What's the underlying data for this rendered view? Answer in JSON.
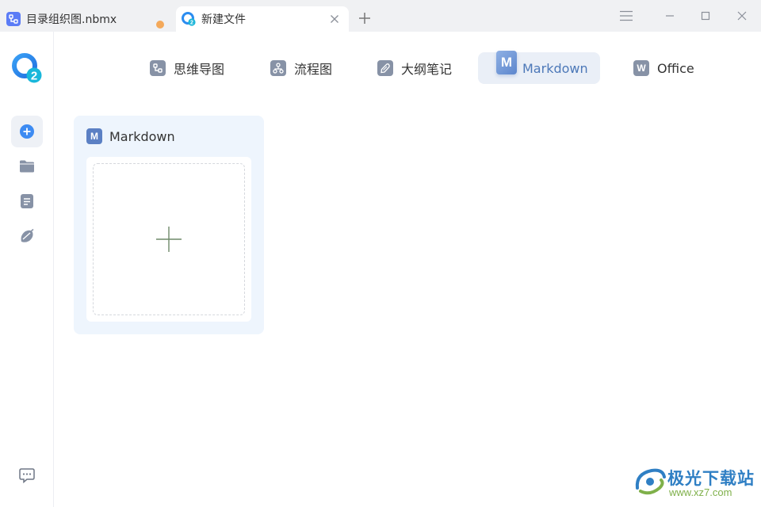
{
  "tabs": [
    {
      "title": "目录组织图.nbmx",
      "icon": "mindmap-file-icon",
      "unsaved": true
    },
    {
      "title": "新建文件",
      "icon": "app-logo-icon",
      "active": true
    }
  ],
  "categories": [
    {
      "label": "思维导图",
      "icon": "mindmap-icon"
    },
    {
      "label": "流程图",
      "icon": "flowchart-icon"
    },
    {
      "label": "大纲笔记",
      "icon": "outline-note-icon"
    },
    {
      "label": "Markdown",
      "icon": "markdown-icon",
      "badge": "M",
      "active": true
    },
    {
      "label": "Office",
      "icon": "office-icon",
      "badge": "W"
    }
  ],
  "card": {
    "title": "Markdown",
    "badge": "M"
  },
  "watermark": {
    "title": "极光下载站",
    "url": "www.xz7.com"
  },
  "colors": {
    "accent": "#3d8bf2",
    "active_tab_text": "#4c78b8",
    "card_bg": "#eef5fd",
    "unsaved_dot": "#f4a95a"
  }
}
